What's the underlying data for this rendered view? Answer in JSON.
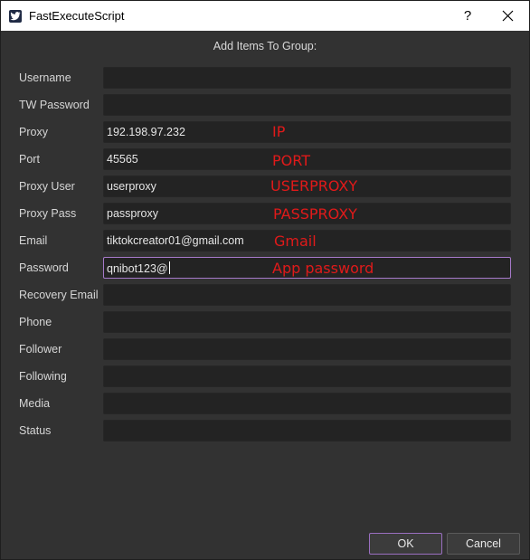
{
  "window": {
    "title": "FastExecuteScript",
    "help_label": "?",
    "app_icon": "twitter-bird-icon",
    "close_icon": "close-icon"
  },
  "dialog": {
    "header": "Add Items To Group:",
    "fields": [
      {
        "label": "Username",
        "value": ""
      },
      {
        "label": "TW Password",
        "value": ""
      },
      {
        "label": "Proxy",
        "value": "192.198.97.232"
      },
      {
        "label": "Port",
        "value": "45565"
      },
      {
        "label": "Proxy User",
        "value": "userproxy"
      },
      {
        "label": "Proxy Pass",
        "value": "passproxy"
      },
      {
        "label": "Email",
        "value": "tiktokcreator01@gmail.com"
      },
      {
        "label": "Password",
        "value": "qnibot123@"
      },
      {
        "label": "Recovery Email",
        "value": ""
      },
      {
        "label": "Phone",
        "value": ""
      },
      {
        "label": "Follower",
        "value": ""
      },
      {
        "label": "Following",
        "value": ""
      },
      {
        "label": "Media",
        "value": ""
      },
      {
        "label": "Status",
        "value": ""
      }
    ],
    "annotations": [
      "IP",
      "PORT",
      "USERPROXY",
      "PASSPROXY",
      "Gmail",
      "App password"
    ],
    "buttons": {
      "ok": "OK",
      "cancel": "Cancel"
    }
  },
  "colors": {
    "background": "#323232",
    "field_background": "#232323",
    "focus_border": "#a679c9",
    "annotation_red": "#e01a1a"
  }
}
